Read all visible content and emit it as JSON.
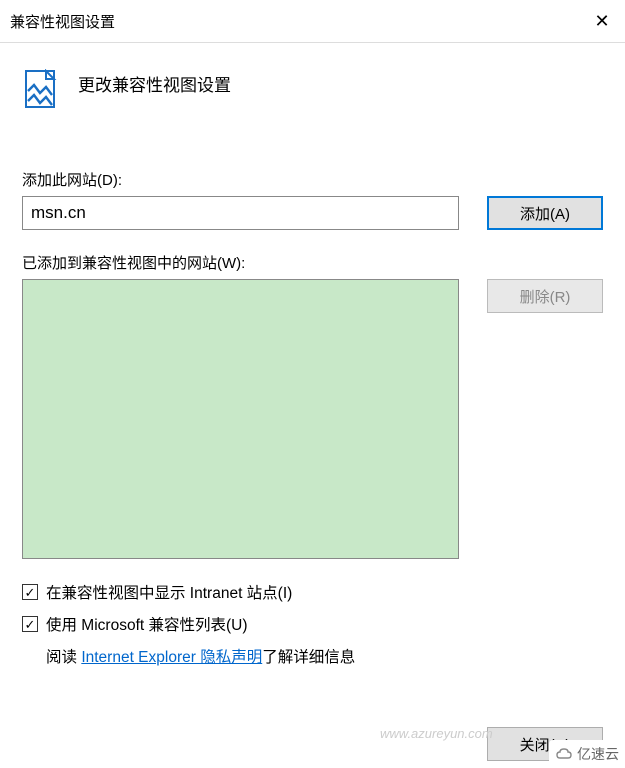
{
  "title": "兼容性视图设置",
  "header": {
    "text": "更改兼容性视图设置"
  },
  "addSection": {
    "label": "添加此网站(D):",
    "value": "msn.cn",
    "button": "添加(A)"
  },
  "listSection": {
    "label": "已添加到兼容性视图中的网站(W):",
    "removeButton": "删除(R)"
  },
  "options": {
    "intranet": {
      "checked": true,
      "label": "在兼容性视图中显示 Intranet 站点(I)"
    },
    "msList": {
      "checked": true,
      "label": "使用 Microsoft 兼容性列表(U)"
    },
    "readPrefix": "阅读 ",
    "readLink": "Internet Explorer 隐私声明",
    "readSuffix": "了解详细信息"
  },
  "footer": {
    "close": "关闭(C)"
  },
  "watermark": "www.azureyun.com",
  "brand": "亿速云"
}
